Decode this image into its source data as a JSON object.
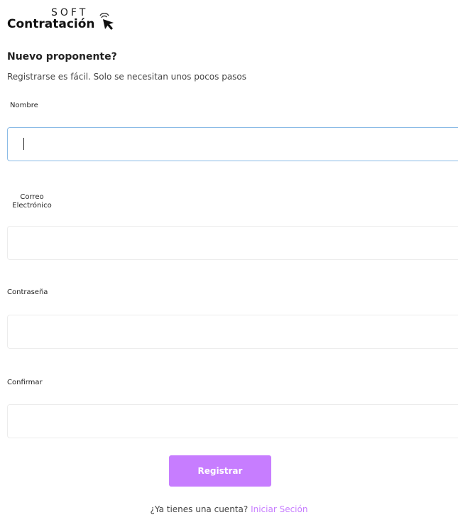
{
  "logo": {
    "top_text": "SOFT",
    "main_text": "Contratación",
    "icon": "cursor-click-icon"
  },
  "form": {
    "title": "Nuevo proponente?",
    "subtitle": "Registrarse es fácil. Solo se necesitan unos pocos pasos",
    "fields": [
      {
        "label": "Nombre",
        "value": "",
        "placeholder": ""
      },
      {
        "label_line1": "Correo",
        "label_line2": "Electrónico",
        "value": "",
        "placeholder": ""
      },
      {
        "label": "Contraseña",
        "value": "",
        "placeholder": ""
      },
      {
        "label": "Confirmar",
        "value": "",
        "placeholder": ""
      }
    ],
    "submit_label": "Registrar",
    "footer_text": "¿Ya tienes una cuenta?",
    "footer_link": "Iniciar Seción"
  },
  "colors": {
    "accent": "#c77dff",
    "focus_border": "#8bbbe6"
  }
}
